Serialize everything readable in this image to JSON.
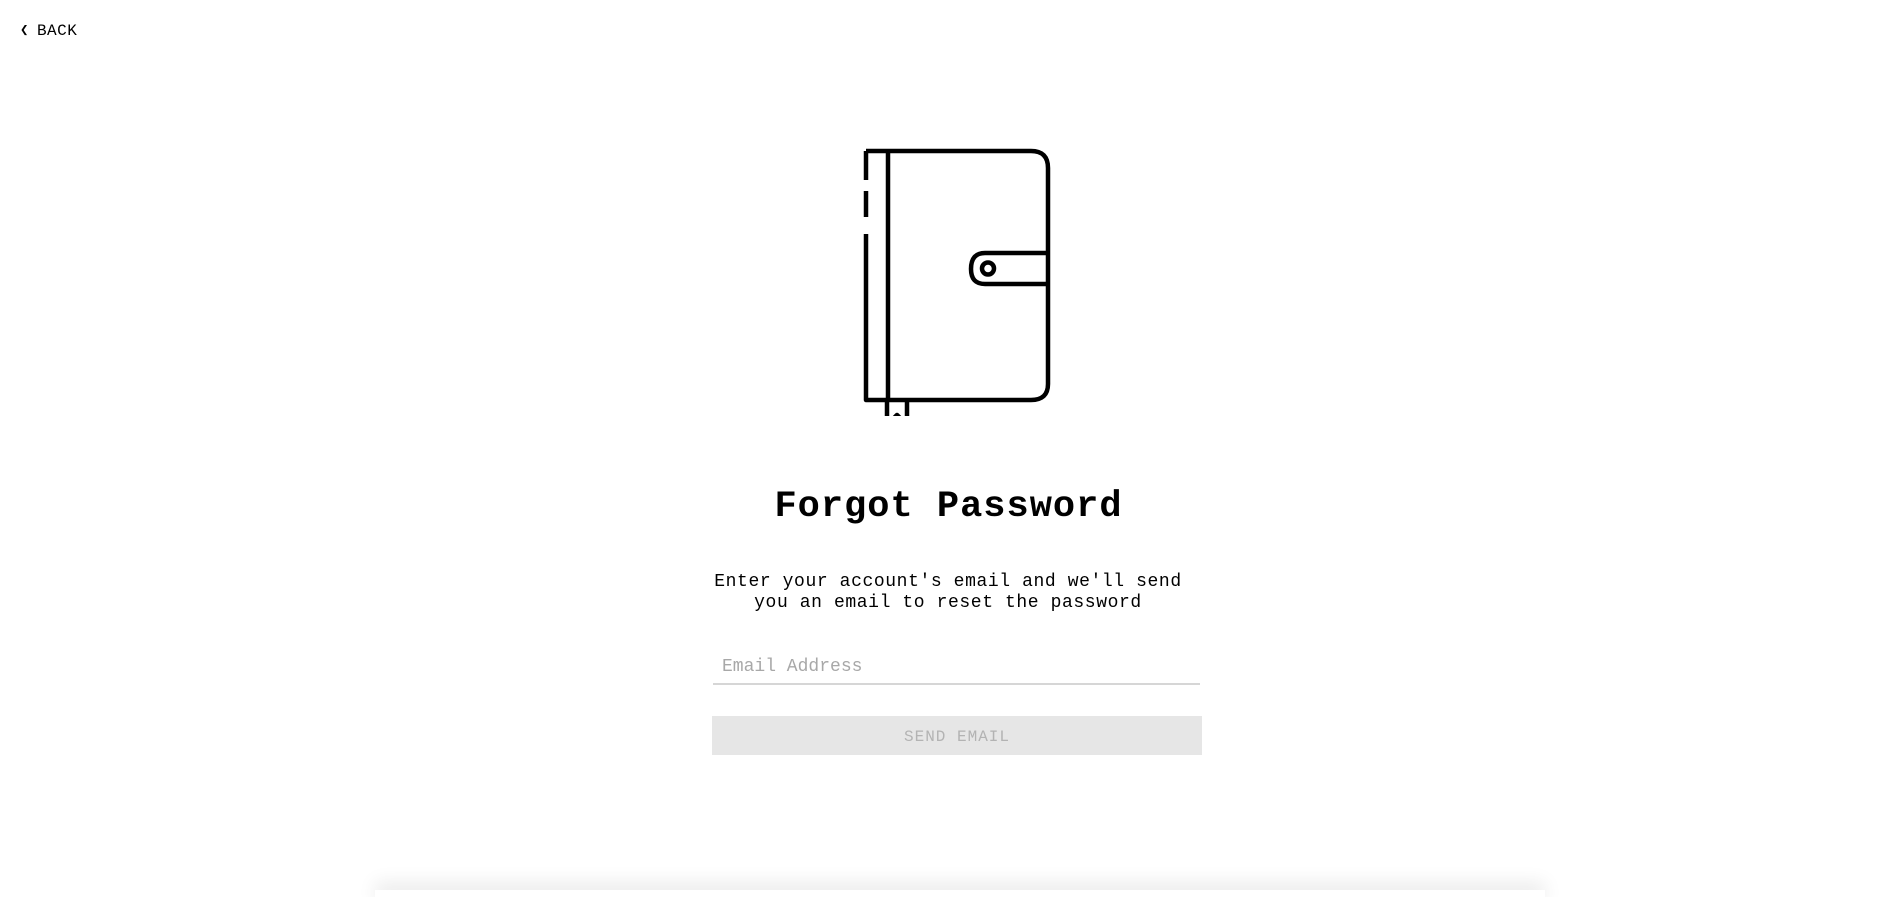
{
  "nav": {
    "back_label": "BACK",
    "back_icon": "chevron-left-icon"
  },
  "hero": {
    "icon": "journal-icon"
  },
  "form": {
    "title": "Forgot Password",
    "description": "Enter your account's email and we'll send you an email to reset the password",
    "email_placeholder": "Email Address",
    "email_value": "",
    "submit_label": "SEND EMAIL",
    "submit_disabled": true
  },
  "colors": {
    "text": "#000000",
    "placeholder": "#a8a8a8",
    "button_bg_disabled": "#e6e6e6",
    "button_text_disabled": "#b3b3b3",
    "input_underline": "#d6d6d6"
  }
}
